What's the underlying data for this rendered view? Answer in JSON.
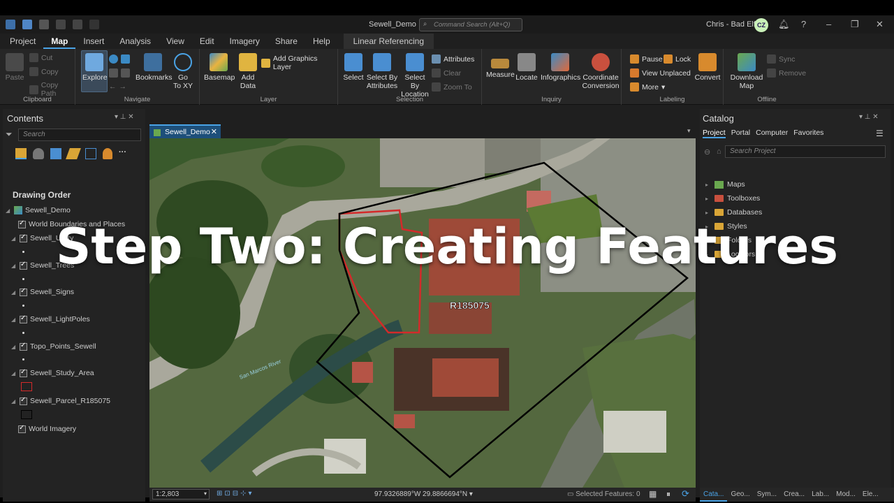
{
  "window": {
    "title": "Sewell_Demo",
    "command_search_placeholder": "Command Search (Alt+Q)",
    "user": "Chris - Bad Elf",
    "user_initials": "CZ"
  },
  "ribbon_tabs": [
    "Project",
    "Map",
    "Insert",
    "Analysis",
    "View",
    "Edit",
    "Imagery",
    "Share",
    "Help"
  ],
  "contextual_tab": "Linear Referencing",
  "ribbon": {
    "clipboard": {
      "label": "Clipboard",
      "paste": "Paste",
      "cut": "Cut",
      "copy": "Copy",
      "copy_path": "Copy Path"
    },
    "navigate": {
      "label": "Navigate",
      "explore": "Explore",
      "bookmarks": "Bookmarks",
      "go_to_xy_line1": "Go",
      "go_to_xy_line2": "To XY"
    },
    "layer": {
      "label": "Layer",
      "basemap": "Basemap",
      "add_data_line1": "Add",
      "add_data_line2": "Data",
      "add_graphics_layer": "Add Graphics Layer"
    },
    "selection": {
      "label": "Selection",
      "select": "Select",
      "select_by_attributes_line1": "Select By",
      "select_by_attributes_line2": "Attributes",
      "select_by_location_line1": "Select By",
      "select_by_location_line2": "Location",
      "attributes": "Attributes",
      "clear": "Clear",
      "zoom_to": "Zoom To"
    },
    "inquiry": {
      "label": "Inquiry",
      "measure": "Measure",
      "locate": "Locate",
      "infographics": "Infographics",
      "coordinate_conversion_line1": "Coordinate",
      "coordinate_conversion_line2": "Conversion"
    },
    "labeling": {
      "label": "Labeling",
      "pause": "Pause",
      "lock": "Lock",
      "view_unplaced": "View Unplaced",
      "more": "More",
      "convert": "Convert"
    },
    "offline": {
      "label": "Offline",
      "download_map_line1": "Download",
      "download_map_line2": "Map",
      "sync": "Sync",
      "remove": "Remove"
    }
  },
  "contents": {
    "title": "Contents",
    "search_placeholder": "Search",
    "drawing_order": "Drawing Order",
    "map_name": "Sewell_Demo",
    "layers": [
      "World Boundaries and Places",
      "Sewell_Utility",
      "Sewell_Trees",
      "Sewell_Signs",
      "Sewell_LightPoles",
      "Topo_Points_Sewell",
      "Sewell_Study_Area",
      "Sewell_Parcel_R185075",
      "World Imagery"
    ]
  },
  "map": {
    "tab_label": "Sewell_Demo",
    "parcel_label": "R185075",
    "river_label": "San Marcos River",
    "scale": "1:2,803",
    "coordinates": "97.9326889°W 29.8866694°N",
    "selected_features": "Selected Features: 0"
  },
  "catalog": {
    "title": "Catalog",
    "tabs": [
      "Project",
      "Portal",
      "Computer",
      "Favorites"
    ],
    "search_placeholder": "Search Project",
    "items": [
      "Maps",
      "Toolboxes",
      "Databases",
      "Styles",
      "Folders",
      "Locators"
    ]
  },
  "bottom_tabs": [
    "Cata...",
    "Geo...",
    "Sym...",
    "Crea...",
    "Lab...",
    "Mod...",
    "Ele..."
  ],
  "overlay_title": "Step Two: Creating Features",
  "colors": {
    "accent": "#4aa3e6",
    "study_area": "#d42a2a",
    "parcel": "#000000"
  }
}
